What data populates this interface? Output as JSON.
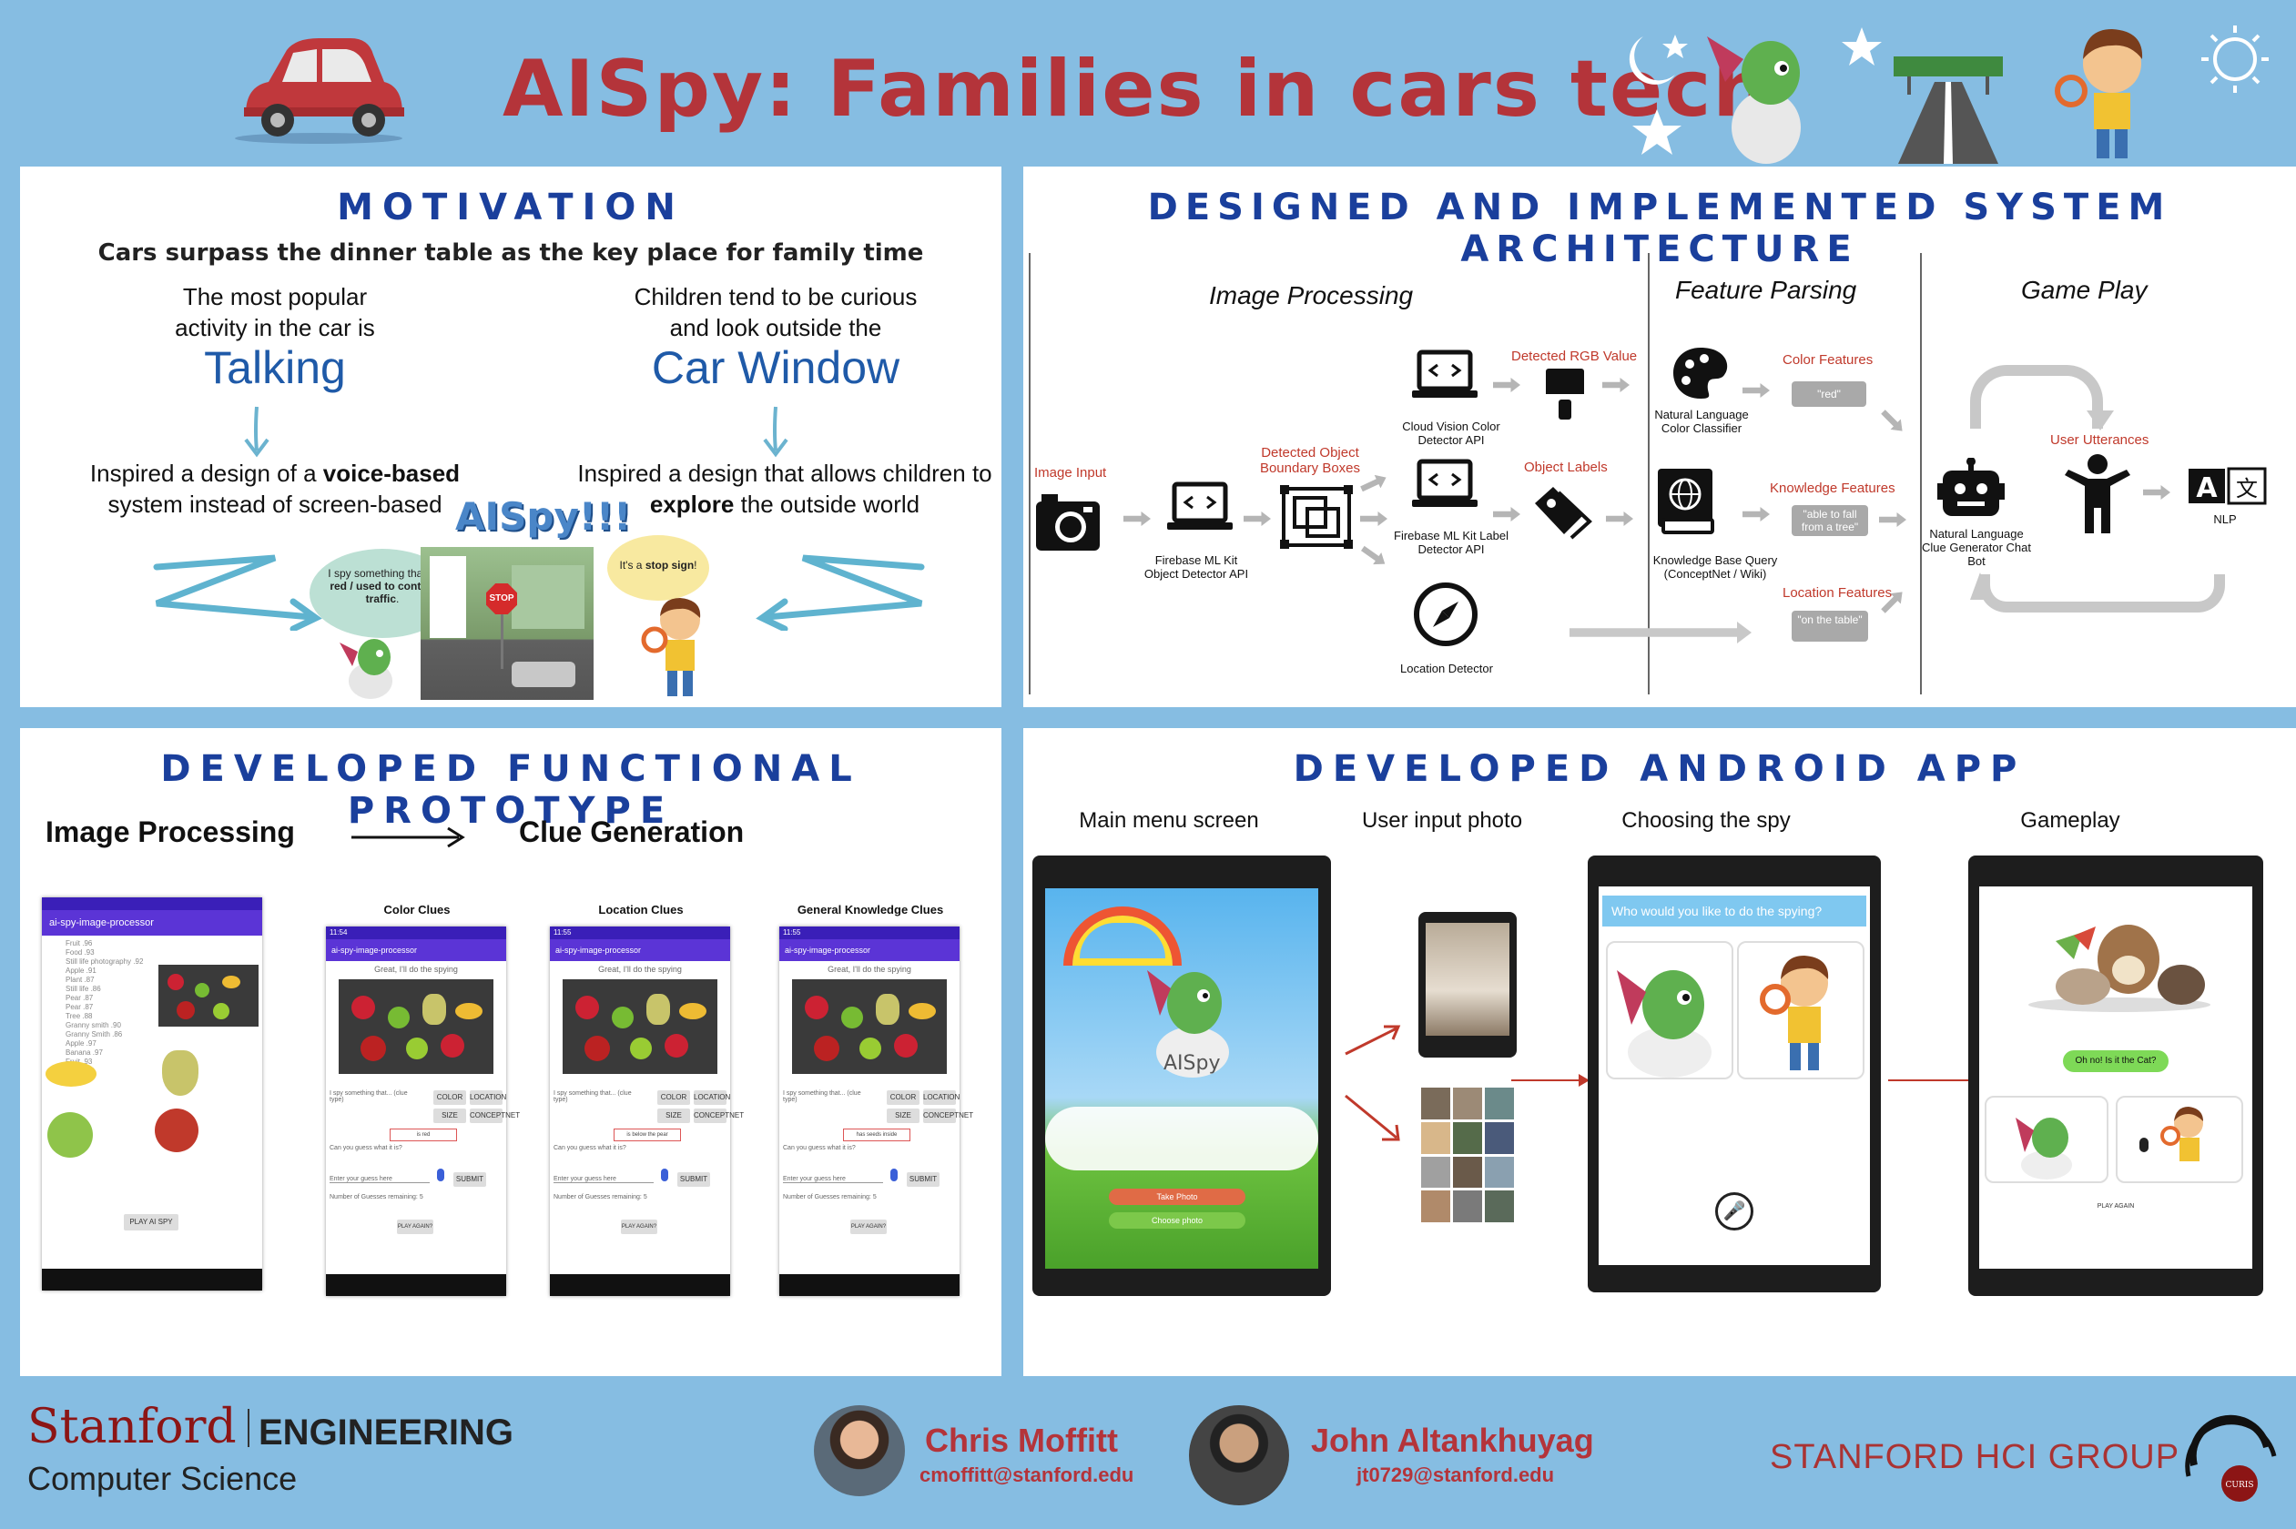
{
  "title": "AISpy: Families in cars tech",
  "motivation": {
    "heading": "MOTIVATION",
    "subtitle": "Cars surpass the dinner table as the key place for family time",
    "left": {
      "line1": "The most popular",
      "line2": "activity in the car is",
      "highlight": "Talking",
      "result_prefix": "Inspired a design of a ",
      "result_bold": "voice-based",
      "result_line2": "system instead of screen-based"
    },
    "right": {
      "line1": "Children tend to be curious",
      "line2": "and look outside the",
      "highlight": "Car Window",
      "result_line1": "Inspired a design that allows children to",
      "result_bold": "explore",
      "result_suffix": " the outside world"
    },
    "logo_text": "AISpy!!!",
    "bubble_left_prefix": "I spy something that is ",
    "bubble_left_bold": "red / used to control traffic",
    "bubble_left_suffix": ".",
    "bubble_right_prefix": "It's a ",
    "bubble_right_bold": "stop sign",
    "bubble_right_suffix": "!",
    "stop_sign": "STOP"
  },
  "architecture": {
    "heading": "DESIGNED AND IMPLEMENTED SYSTEM ARCHITECTURE",
    "col_image": "Image Processing",
    "col_feature": "Feature Parsing",
    "col_game": "Game Play",
    "image_input": "Image Input",
    "detected_boxes": "Detected Object Boundary Boxes",
    "firebase_object": "Firebase ML Kit Object Detector API",
    "cloud_vision": "Cloud Vision Color Detector API",
    "detected_rgb": "Detected RGB Value",
    "label_detector": "Firebase ML Kit Label Detector API",
    "object_labels": "Object Labels",
    "location_detector": "Location Detector",
    "color_classifier": "Natural Language Color Classifier",
    "color_features": "Color Features",
    "red_pill": "\"red\"",
    "kb_query": "Knowledge Base Query (ConceptNet / Wiki)",
    "knowledge_features": "Knowledge Features",
    "fall_pill": "\"able to fall from a tree\"",
    "location_features": "Location Features",
    "table_pill": "\"on the table\"",
    "user_utterances": "User Utterances",
    "chat_bot": "Natural Language Clue Generator Chat Bot",
    "nlp": "NLP"
  },
  "prototype": {
    "heading": "DEVELOPED FUNCTIONAL PROTOTYPE",
    "left_label": "Image Processing",
    "right_label": "Clue Generation",
    "processor_title": "ai-spy-image-processor",
    "play_button": "PLAY AI SPY",
    "screens": [
      {
        "title": "Color Clues",
        "time": "11:54",
        "answer": "is red"
      },
      {
        "title": "Location Clues",
        "time": "11:55",
        "answer": "is below the pear"
      },
      {
        "title": "General Knowledge Clues",
        "time": "11:55",
        "answer": "has seeds inside"
      }
    ],
    "great": "Great, I'll do the spying",
    "i_spy": "I spy something that... (clue type)",
    "can_you": "Can you guess what it is?",
    "enter_guess": "Enter your guess here",
    "submit": "SUBMIT",
    "guesses_left": "Number of Guesses remaining: 5",
    "play_again": "PLAY AGAIN?",
    "clue_buttons": [
      "COLOR",
      "LOCATION",
      "SIZE",
      "CONCEPTNET"
    ]
  },
  "android": {
    "heading": "DEVELOPED ANDROID APP",
    "main_menu": "Main menu screen",
    "user_input": "User input photo",
    "choosing": "Choosing the spy",
    "gameplay": "Gameplay",
    "logo": "AISpy",
    "take_photo": "Take Photo",
    "choose_photo": "Choose photo",
    "who_spy": "Who would you like to do the spying?",
    "oh_no": "Oh no! Is it the Cat?",
    "play_again": "PLAY AGAIN"
  },
  "footer": {
    "stanford": "Stanford",
    "engineering": "ENGINEERING",
    "cs": "Computer Science",
    "author1": "Chris Moffitt",
    "email1": "cmoffitt@stanford.edu",
    "author2": "John Altankhuyag",
    "email2": "jt0729@stanford.edu",
    "hci": "STANFORD HCI GROUP",
    "curis": "CURIS"
  },
  "colors": {
    "brand_red": "#b4343a",
    "heading_blue": "#1a3f9c",
    "background": "#86bde2",
    "app_purple": "#5b34d6"
  }
}
